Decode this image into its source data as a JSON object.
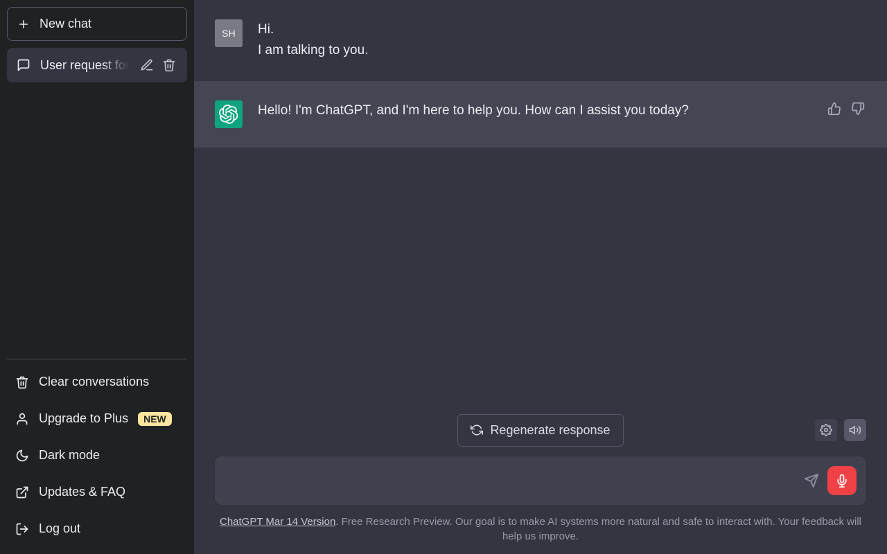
{
  "sidebar": {
    "new_chat_label": "New chat",
    "conversations": [
      {
        "title": "User request for"
      }
    ],
    "footer": {
      "clear_label": "Clear conversations",
      "upgrade_label": "Upgrade to Plus",
      "upgrade_badge": "NEW",
      "dark_mode_label": "Dark mode",
      "updates_label": "Updates & FAQ",
      "logout_label": "Log out"
    }
  },
  "chat": {
    "messages": [
      {
        "role": "user",
        "avatar": "SH",
        "lines": [
          "Hi.",
          "I am talking to you."
        ]
      },
      {
        "role": "assistant",
        "text": "Hello! I'm ChatGPT, and I'm here to help you. How can I assist you today?"
      }
    ]
  },
  "controls": {
    "regenerate_label": "Regenerate response",
    "input_placeholder": ""
  },
  "footer_note": {
    "link_text": "ChatGPT Mar 14 Version",
    "rest_text": ". Free Research Preview. Our goal is to make AI systems more natural and safe to interact with. Your feedback will help us improve."
  }
}
